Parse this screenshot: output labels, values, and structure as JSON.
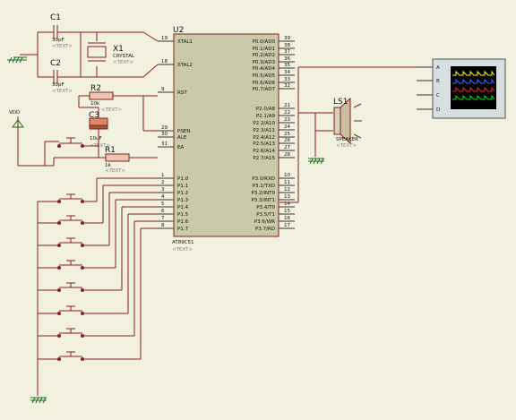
{
  "ground_symbols": 4,
  "components": {
    "c1": {
      "ref": "C1",
      "value": "30pF",
      "text": "<TEXT>"
    },
    "c2": {
      "ref": "C2",
      "value": "30pF",
      "text": "<TEXT>"
    },
    "x1": {
      "ref": "X1",
      "value": "CRYSTAL",
      "text": "<TEXT>"
    },
    "r2": {
      "ref": "R2",
      "value": "10k",
      "text": "<TEXT>"
    },
    "c3": {
      "ref": "C3",
      "value": "10uF",
      "text": "<TEXT>"
    },
    "r1": {
      "ref": "R1",
      "value": "1k",
      "text": "<TEXT>"
    },
    "vdd": {
      "label": "VDD"
    },
    "ls1": {
      "ref": "LS1",
      "value": "SPEAKER",
      "text": "<TEXT>"
    },
    "u2": {
      "ref": "U2",
      "part": "AT89C51",
      "text": "<TEXT>"
    },
    "scope": {
      "channels": [
        "A",
        "B",
        "C",
        "D"
      ],
      "trace_colors": [
        "#ffff00",
        "#3a6bff",
        "#ff2020",
        "#20d020"
      ]
    }
  },
  "u2_pins_left": [
    {
      "num": "19",
      "name": "XTAL1"
    },
    {
      "num": "18",
      "name": "XTAL2"
    },
    {
      "num": "9",
      "name": "RST"
    },
    {
      "num": "29",
      "name": "PSEN"
    },
    {
      "num": "30",
      "name": "ALE"
    },
    {
      "num": "31",
      "name": "EA"
    },
    {
      "num": "1",
      "name": "P1.0"
    },
    {
      "num": "2",
      "name": "P1.1"
    },
    {
      "num": "3",
      "name": "P1.2"
    },
    {
      "num": "4",
      "name": "P1.3"
    },
    {
      "num": "5",
      "name": "P1.4"
    },
    {
      "num": "6",
      "name": "P1.5"
    },
    {
      "num": "7",
      "name": "P1.6"
    },
    {
      "num": "8",
      "name": "P1.7"
    }
  ],
  "u2_pins_right": [
    {
      "num": "39",
      "name": "P0.0/AD0"
    },
    {
      "num": "38",
      "name": "P0.1/AD1"
    },
    {
      "num": "37",
      "name": "P0.2/AD2"
    },
    {
      "num": "36",
      "name": "P0.3/AD3"
    },
    {
      "num": "35",
      "name": "P0.4/AD4"
    },
    {
      "num": "34",
      "name": "P0.5/AD5"
    },
    {
      "num": "33",
      "name": "P0.6/AD6"
    },
    {
      "num": "32",
      "name": "P0.7/AD7"
    },
    {
      "num": "21",
      "name": "P2.0/A8"
    },
    {
      "num": "22",
      "name": "P2.1/A9"
    },
    {
      "num": "23",
      "name": "P2.2/A10"
    },
    {
      "num": "24",
      "name": "P2.3/A11"
    },
    {
      "num": "25",
      "name": "P2.4/A12"
    },
    {
      "num": "26",
      "name": "P2.5/A13"
    },
    {
      "num": "27",
      "name": "P2.6/A14"
    },
    {
      "num": "28",
      "name": "P2.7/A15"
    },
    {
      "num": "10",
      "name": "P3.0/RXD"
    },
    {
      "num": "11",
      "name": "P3.1/TXD"
    },
    {
      "num": "12",
      "name": "P3.2/INT0"
    },
    {
      "num": "13",
      "name": "P3.3/INT1"
    },
    {
      "num": "14",
      "name": "P3.4/T0"
    },
    {
      "num": "15",
      "name": "P3.5/T1"
    },
    {
      "num": "16",
      "name": "P3.6/WR"
    },
    {
      "num": "17",
      "name": "P3.7/RD"
    }
  ],
  "buttons_count": 9
}
